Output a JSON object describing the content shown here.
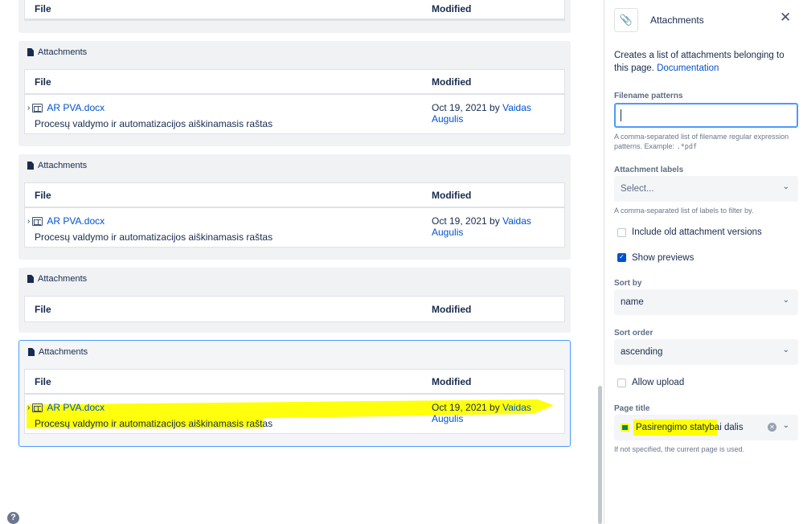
{
  "editor": {
    "file_header": "File",
    "modified_header": "Modified",
    "macro_title": "Attachments",
    "attachment_row": {
      "file_name": "AR PVA.docx",
      "date": "Oct 19, 2021 by",
      "author": "Vaidas Augulis",
      "description": "Procesų valdymo ir automatizacijos aiškinamasis raštas"
    },
    "help_glyph": "?"
  },
  "panel": {
    "title": "Attachments",
    "close_glyph": "✕",
    "icon_glyph": "📎",
    "description": "Creates a list of attachments belonging to this page.",
    "doc_link": "Documentation",
    "filename_patterns_label": "Filename patterns",
    "filename_patterns_value": "",
    "filename_help": "A comma-separated list of filename regular expression patterns. Example:",
    "filename_example": ".*pdf",
    "labels_label": "Attachment labels",
    "labels_placeholder": "Select...",
    "labels_help": "A comma-separated list of labels to filter by.",
    "include_old_label": "Include old attachment versions",
    "include_old_checked": false,
    "show_previews_label": "Show previews",
    "show_previews_checked": true,
    "sort_by_label": "Sort by",
    "sort_by_value": "name",
    "sort_order_label": "Sort order",
    "sort_order_value": "ascending",
    "allow_upload_label": "Allow upload",
    "allow_upload_checked": false,
    "page_title_label": "Page title",
    "page_title_value": "Pasirengimo statybai dalis",
    "page_title_help": "If not specified, the current page is used.",
    "dropdown_glyph": "⌄",
    "clear_glyph": "✕",
    "check_glyph": "✓"
  },
  "colors": {
    "highlight": "#ffff00",
    "link": "#0052cc",
    "focus_border": "#4c9aff",
    "macro_bg": "#f1f2f4"
  }
}
